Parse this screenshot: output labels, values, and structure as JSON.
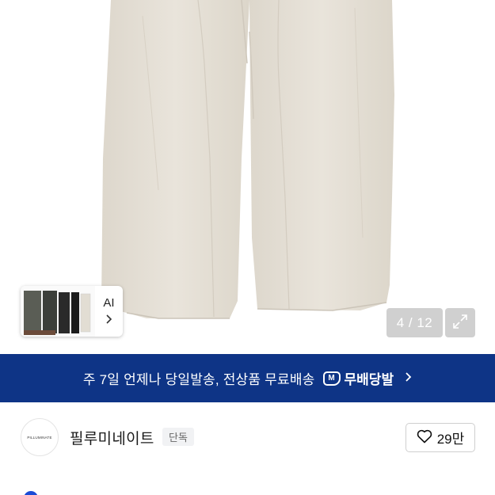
{
  "gallery": {
    "ai_label": "AI",
    "counter": "4 / 12"
  },
  "banner": {
    "text": "주 7일 언제나 당일발송, 전상품 무료배송",
    "badge_icon_letter": "M",
    "badge_text": "무배당발"
  },
  "store": {
    "logo_text": "PILLUMINATE",
    "name": "필루미네이트",
    "tag": "단독",
    "like_count": "29만"
  },
  "colors": {
    "banner_bg": "#0e3486",
    "pants": "#e6e1d7"
  }
}
